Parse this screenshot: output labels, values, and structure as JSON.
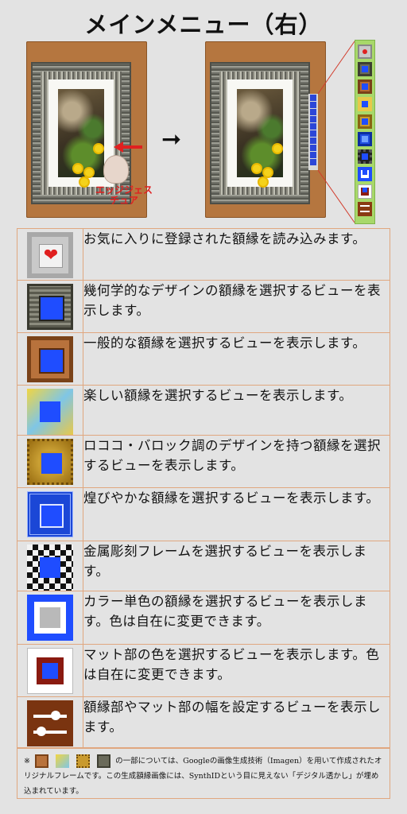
{
  "title": "メインメニュー（右）",
  "gesture_label": "エッジジェスチュア",
  "menu": [
    {
      "icon": "heart-frame-icon",
      "text": "お気に入りに登録された額縁を読み込みます。"
    },
    {
      "icon": "geometric-frame-icon",
      "text": "幾何学的なデザインの額縁を選択するビューを表示します。"
    },
    {
      "icon": "general-frame-icon",
      "text": "一般的な額縁を選択するビューを表示します。"
    },
    {
      "icon": "fun-frame-icon",
      "text": "楽しい額縁を選択するビューを表示します。"
    },
    {
      "icon": "rococo-baroque-frame-icon",
      "text": "ロココ・バロック調のデザインを持つ額縁を選択するビューを表示します。"
    },
    {
      "icon": "gorgeous-frame-icon",
      "text": "煌びやかな額縁を選択するビューを表示します。"
    },
    {
      "icon": "metal-engraved-frame-icon",
      "text": "金属彫刻フレームを選択するビューを表示します。"
    },
    {
      "icon": "solid-color-frame-icon",
      "text": "カラー単色の額縁を選択するビューを表示します。色は自在に変更できます。"
    },
    {
      "icon": "mat-color-icon",
      "text": "マット部の色を選択するビューを表示します。色は自在に変更できます。"
    },
    {
      "icon": "width-sliders-icon",
      "text": "額縁部やマット部の幅を設定するビューを表示します。"
    }
  ],
  "note": {
    "mark": "※",
    "text_after_icons": "の一部については、Googleの画像生成技術（Imagen）を用いて作成されたオリジナルフレームです。この生成額縁画像には、SynthIDという目に見えない「デジタル透かし」が埋め込まれています。"
  },
  "colors": {
    "accent_blue": "#1f4dff",
    "callout_green": "#a8d86a",
    "gesture_red": "#e02020",
    "row_border": "#e0a77f"
  }
}
